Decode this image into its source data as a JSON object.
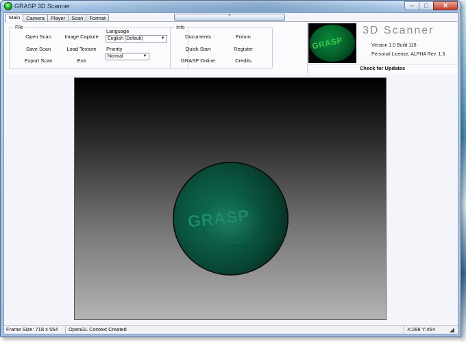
{
  "window": {
    "title": "GRASP 3D Scanner",
    "controls": {
      "minimize": "–",
      "maximize": "□",
      "close": "✕"
    }
  },
  "tabs": [
    {
      "label": "Main",
      "active": true
    },
    {
      "label": "Camera"
    },
    {
      "label": "Player"
    },
    {
      "label": "Scan"
    },
    {
      "label": "Format"
    }
  ],
  "collapse_glyph": "⌃",
  "file_group": {
    "label": "File",
    "buttons": {
      "open_scan": "Open Scan",
      "image_capture": "Image Capture",
      "save_scan": "Save Scan",
      "load_texture": "Load Texture",
      "export_scan": "Export Scan",
      "exit": "Exit"
    },
    "language_label": "Language",
    "language_value": "English (Default)",
    "priority_label": "Priority",
    "priority_value": "Normal"
  },
  "info_group": {
    "label": "Info",
    "buttons": {
      "documents": "Documents",
      "forum": "Forum",
      "quick_start": "Quick Start",
      "register": "Register",
      "grasp_online": "GRASP Online",
      "credits": "Credits"
    }
  },
  "splash": {
    "logo_text": "GRASP",
    "title": "3D Scanner",
    "version": "Version 1.0  Build 118",
    "license": "Personal License, ALPHA Rev. 1.3",
    "check_updates": "Check for Updates"
  },
  "viewport": {
    "logo_text": "GRASP"
  },
  "statusbar": {
    "frame_size": "Frame Size: 718 x 554",
    "context": "OpenGL Context Created",
    "cursor": "X:288 Y:454"
  },
  "colors": {
    "sphere": "#0b5a45",
    "logo_green": "#38c44e",
    "titlebar": "#a9c6e6"
  }
}
